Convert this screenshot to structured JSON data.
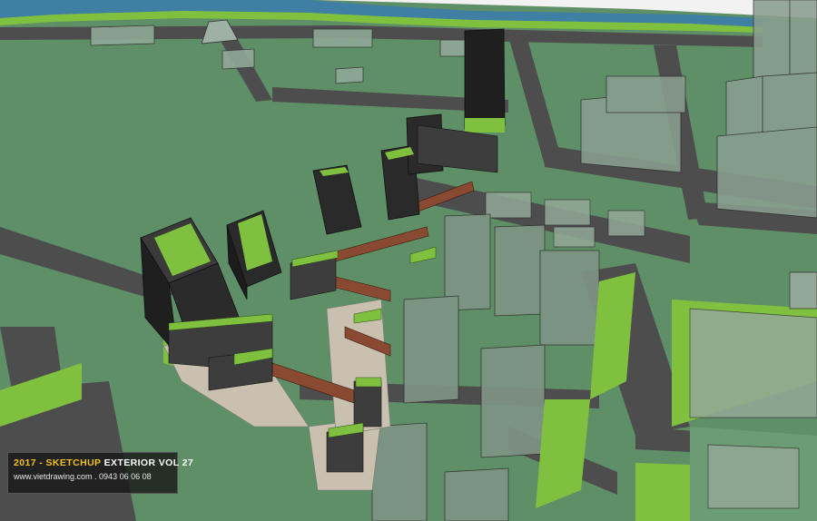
{
  "watermark": {
    "year": "2017",
    "separator": " - ",
    "product": "SKETCHUP",
    "volume": " EXTERIOR VOL 27",
    "website": "www.vietdrawing.com",
    "divider": " . ",
    "phone": "0943 06 06 08"
  },
  "colors": {
    "ground": "#5f8f66",
    "road": "#4d4d4d",
    "water": "#3f7fa3",
    "park": "#7fc13f",
    "tower": "#2a2a2a",
    "glass": "#8fa896",
    "bridge": "#8a4a32"
  }
}
